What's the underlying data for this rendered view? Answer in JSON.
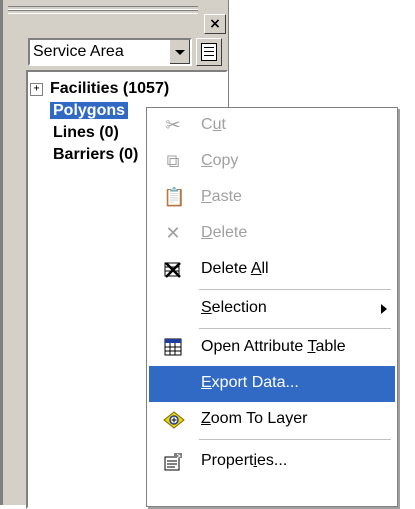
{
  "panel": {
    "close_glyph": "×",
    "layer_select": {
      "value": "Service Area"
    },
    "tree": [
      {
        "label": "Facilities (1057)",
        "expander": "+"
      },
      {
        "label": "Polygons"
      },
      {
        "label": "Lines (0)"
      },
      {
        "label": "Barriers (0)"
      }
    ]
  },
  "context_menu": {
    "items": [
      {
        "pre": "C",
        "ul": "u",
        "post": "t",
        "icon": "cut-icon",
        "enabled": false
      },
      {
        "pre": "",
        "ul": "C",
        "post": "opy",
        "icon": "copy-icon",
        "enabled": false
      },
      {
        "pre": "",
        "ul": "P",
        "post": "aste",
        "icon": "paste-icon",
        "enabled": false
      },
      {
        "pre": "",
        "ul": "D",
        "post": "elete",
        "icon": "delete-icon",
        "enabled": false
      },
      {
        "pre": "Delete ",
        "ul": "A",
        "post": "ll",
        "icon": "delete-all-icon",
        "enabled": true
      },
      {
        "pre": "",
        "ul": "S",
        "post": "election",
        "icon": "",
        "enabled": true,
        "submenu": true
      },
      {
        "pre": "Open Attribute ",
        "ul": "T",
        "post": "able",
        "icon": "table-icon",
        "enabled": true
      },
      {
        "pre": "",
        "ul": "E",
        "post": "xport Data...",
        "icon": "",
        "enabled": true,
        "highlighted": true
      },
      {
        "pre": "",
        "ul": "Z",
        "post": "oom To Layer",
        "icon": "zoom-to-layer-icon",
        "enabled": true
      },
      {
        "pre": "Propert",
        "ul": "i",
        "post": "es...",
        "icon": "properties-icon",
        "enabled": true
      }
    ]
  },
  "colors": {
    "selection": "#316ac5",
    "face": "#d4d0c8",
    "disabled": "#a0a0a0"
  }
}
